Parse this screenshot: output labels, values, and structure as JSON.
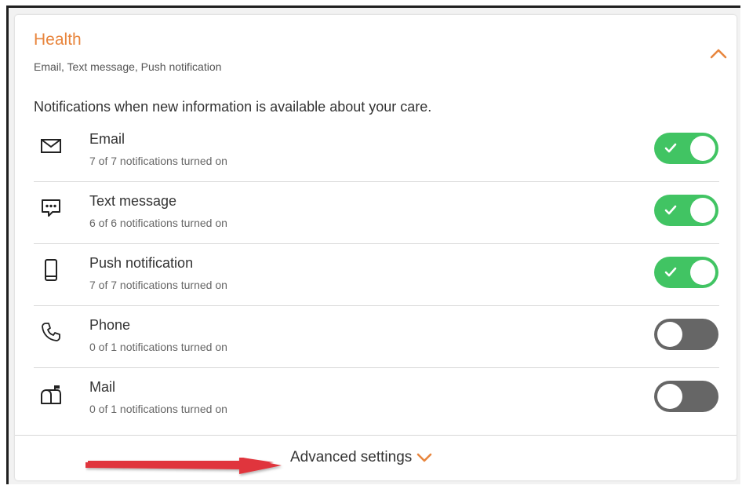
{
  "header": {
    "title": "Health",
    "subtitle": "Email, Text message, Push notification"
  },
  "description": "Notifications when new information is available about your care.",
  "channels": [
    {
      "label": "Email",
      "status": "7 of 7 notifications turned on",
      "icon": "envelope-icon",
      "enabled": true
    },
    {
      "label": "Text message",
      "status": "6 of 6 notifications turned on",
      "icon": "chat-bubble-icon",
      "enabled": true
    },
    {
      "label": "Push notification",
      "status": "7 of 7 notifications turned on",
      "icon": "mobile-phone-icon",
      "enabled": true
    },
    {
      "label": "Phone",
      "status": "0 of 1 notifications turned on",
      "icon": "phone-handset-icon",
      "enabled": false
    },
    {
      "label": "Mail",
      "status": "0 of 1 notifications turned on",
      "icon": "mailbox-icon",
      "enabled": false
    }
  ],
  "footer": {
    "advanced_label": "Advanced settings"
  },
  "colors": {
    "accent_orange": "#e8853d",
    "toggle_on": "#41c463",
    "toggle_off": "#666666",
    "annotation_arrow": "#e0363c"
  }
}
